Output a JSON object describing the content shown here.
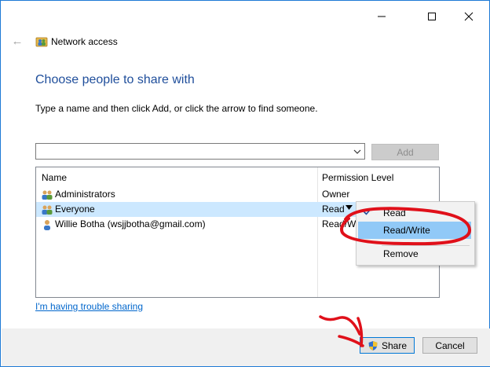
{
  "window": {
    "title": "Network access",
    "controls": [
      "minimize-icon",
      "maximize-icon",
      "close-icon"
    ]
  },
  "heading": "Choose people to share with",
  "instruction": "Type a name and then click Add, or click the arrow to find someone.",
  "name_input": {
    "value": "",
    "placeholder": ""
  },
  "add_label": "Add",
  "table": {
    "headers": [
      "Name",
      "Permission Level"
    ],
    "rows": [
      {
        "name": "Administrators",
        "permission": "Owner",
        "icon": "group-users-icon"
      },
      {
        "name": "Everyone",
        "permission": "Read",
        "icon": "group-users-icon",
        "selected": true
      },
      {
        "name": "Willie Botha (wsjjbotha@gmail.com)",
        "permission": "Read/Wr",
        "icon": "user-icon"
      }
    ]
  },
  "menu": {
    "items": [
      "Read",
      "Read/Write",
      "Remove"
    ],
    "checked": "Read",
    "highlighted": "Read/Write"
  },
  "trouble_link": "I'm having trouble sharing",
  "buttons": {
    "share": "Share",
    "cancel": "Cancel"
  },
  "colors": {
    "accent": "#1e7ad6",
    "heading": "#1f4e9b",
    "selection": "#cce8ff",
    "menu_highlight": "#91c9f7",
    "annotation": "#e0101a"
  }
}
